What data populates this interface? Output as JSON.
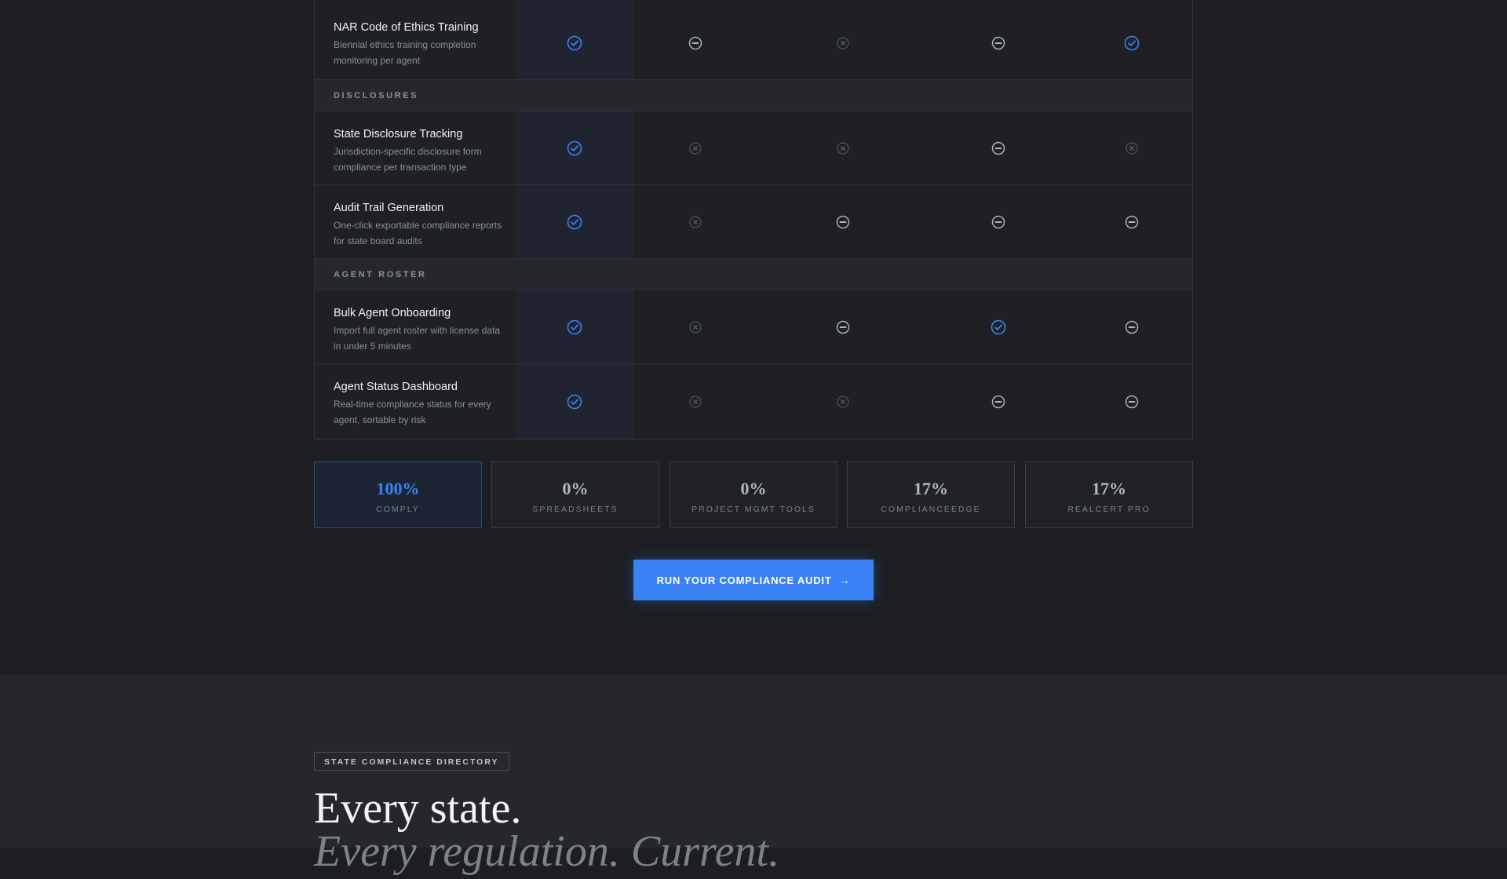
{
  "colors": {
    "accent": "#3b82f6",
    "background": "#1c1e22",
    "muted": "#8b9098"
  },
  "columns": [
    "Comply",
    "Spreadsheets",
    "Project Mgmt Tools",
    "ComplianceEdge",
    "RealCert Pro"
  ],
  "rows": [
    {
      "type": "feature",
      "title": "NAR Code of Ethics Training",
      "desc": "Biennial ethics training completion monitoring per agent",
      "values": [
        "check",
        "partial",
        "no",
        "partial",
        "check"
      ]
    },
    {
      "type": "section",
      "label": "DISCLOSURES"
    },
    {
      "type": "feature",
      "title": "State Disclosure Tracking",
      "desc": "Jurisdiction-specific disclosure form compliance per transaction type",
      "values": [
        "check",
        "no",
        "no",
        "partial",
        "no"
      ]
    },
    {
      "type": "feature",
      "title": "Audit Trail Generation",
      "desc": "One-click exportable compliance reports for state board audits",
      "values": [
        "check",
        "no",
        "partial",
        "partial",
        "partial"
      ]
    },
    {
      "type": "section",
      "label": "AGENT ROSTER"
    },
    {
      "type": "feature",
      "title": "Bulk Agent Onboarding",
      "desc": "Import full agent roster with license data in under 5 minutes",
      "values": [
        "check",
        "no",
        "partial",
        "check",
        "partial"
      ]
    },
    {
      "type": "feature",
      "title": "Agent Status Dashboard",
      "desc": "Real-time compliance status for every agent, sortable by risk",
      "values": [
        "check",
        "no",
        "no",
        "partial",
        "partial"
      ]
    }
  ],
  "stats": [
    {
      "value": "100%",
      "label": "COMPLY",
      "highlight": true
    },
    {
      "value": "0%",
      "label": "SPREADSHEETS"
    },
    {
      "value": "0%",
      "label": "PROJECT MGMT TOOLS"
    },
    {
      "value": "17%",
      "label": "COMPLIANCEEDGE"
    },
    {
      "value": "17%",
      "label": "REALCERT PRO"
    }
  ],
  "cta": {
    "label": "RUN YOUR COMPLIANCE AUDIT",
    "icon": "arrow-right-icon",
    "arrow": "→"
  },
  "directory": {
    "badge": "STATE COMPLIANCE DIRECTORY",
    "headline": "Every state.",
    "subheadline": "Every regulation. Current."
  }
}
